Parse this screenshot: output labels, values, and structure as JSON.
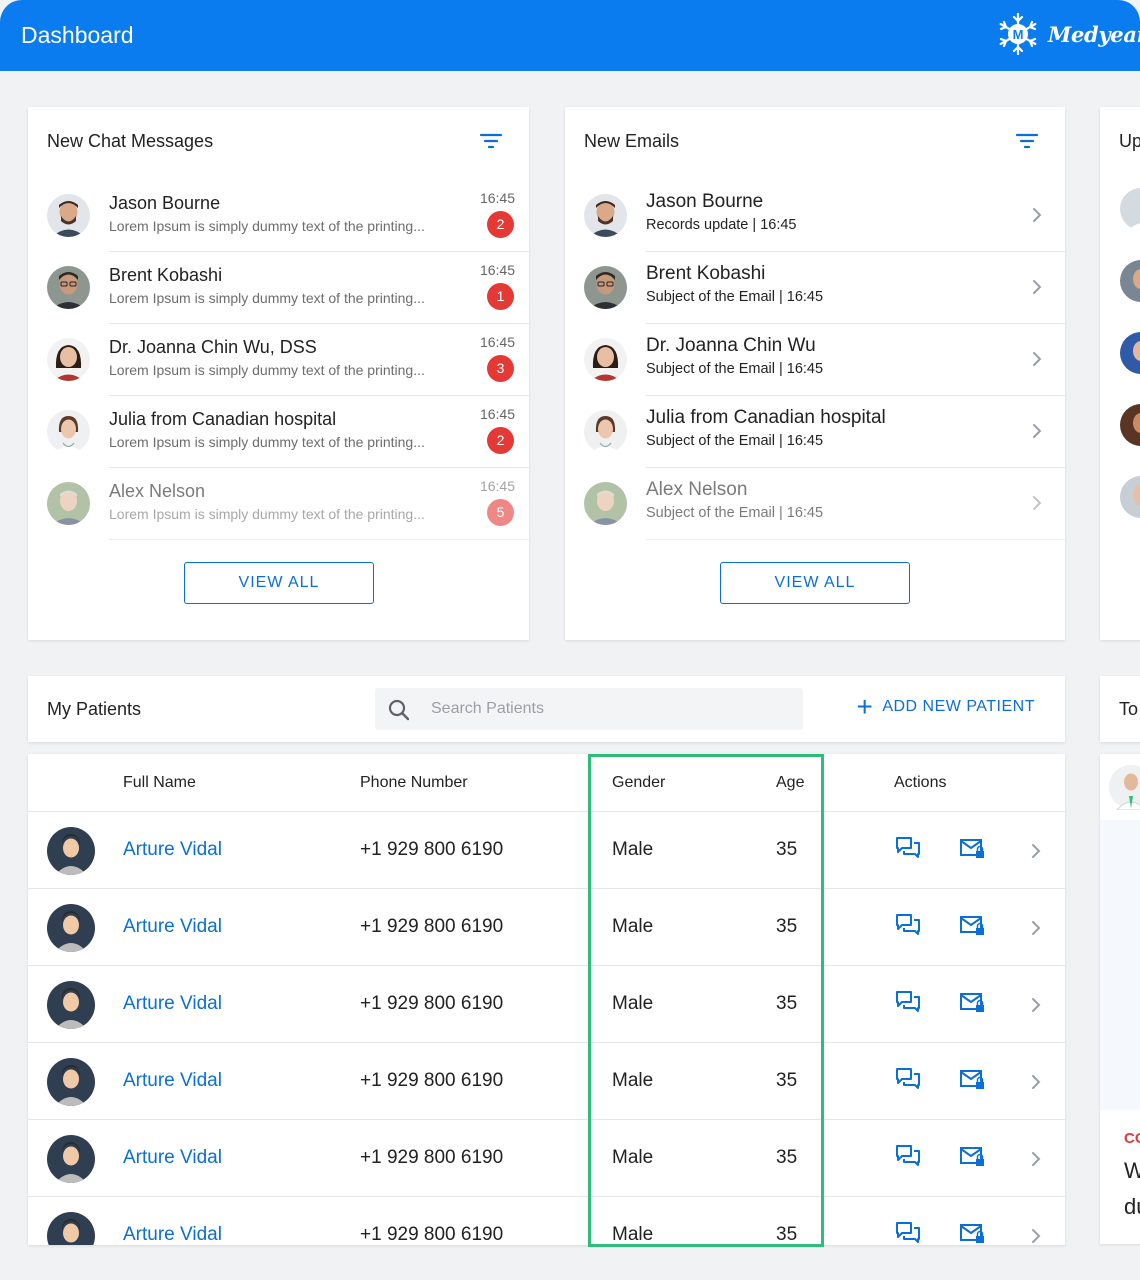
{
  "header": {
    "title": "Dashboard",
    "brand": "Medyear",
    "brand_logo_letter": "M"
  },
  "chat": {
    "title": "New Chat Messages",
    "view_all": "VIEW ALL",
    "items": [
      {
        "name": "Jason Bourne",
        "preview": "Lorem Ipsum is simply dummy text of the printing...",
        "time": "16:45",
        "badge": "2"
      },
      {
        "name": "Brent Kobashi",
        "preview": "Lorem Ipsum is simply dummy text of the printing...",
        "time": "16:45",
        "badge": "1"
      },
      {
        "name": "Dr. Joanna Chin Wu, DSS",
        "preview": "Lorem Ipsum is simply dummy text of the printing...",
        "time": "16:45",
        "badge": "3"
      },
      {
        "name": "Julia from Canadian hospital",
        "preview": "Lorem Ipsum is simply dummy text of the printing...",
        "time": "16:45",
        "badge": "2"
      },
      {
        "name": "Alex Nelson",
        "preview": "Lorem Ipsum is simply dummy text of the printing...",
        "time": "16:45",
        "badge": "5"
      }
    ]
  },
  "emails": {
    "title": "New Emails",
    "view_all": "VIEW ALL",
    "items": [
      {
        "name": "Jason Bourne",
        "subject": "Records update | 16:45"
      },
      {
        "name": "Brent Kobashi",
        "subject": "Subject of the Email | 16:45"
      },
      {
        "name": "Dr. Joanna Chin Wu",
        "subject": "Subject of the Email | 16:45"
      },
      {
        "name": "Julia from Canadian hospital",
        "subject": "Subject of the Email | 16:45"
      },
      {
        "name": "Alex Nelson",
        "subject": "Subject of the Email | 16:45"
      }
    ]
  },
  "upcoming": {
    "title_partial": "Up"
  },
  "patients": {
    "title": "My Patients",
    "search_placeholder": "Search Patients",
    "add_label": "ADD NEW PATIENT",
    "columns": {
      "name": "Full Name",
      "phone": "Phone Number",
      "gender": "Gender",
      "age": "Age",
      "actions": "Actions"
    },
    "rows": [
      {
        "name": "Arture Vidal",
        "phone": "+1 929 800 6190",
        "gender": "Male",
        "age": "35"
      },
      {
        "name": "Arture Vidal",
        "phone": "+1 929 800 6190",
        "gender": "Male",
        "age": "35"
      },
      {
        "name": "Arture Vidal",
        "phone": "+1 929 800 6190",
        "gender": "Male",
        "age": "35"
      },
      {
        "name": "Arture Vidal",
        "phone": "+1 929 800 6190",
        "gender": "Male",
        "age": "35"
      },
      {
        "name": "Arture Vidal",
        "phone": "+1 929 800 6190",
        "gender": "Male",
        "age": "35"
      },
      {
        "name": "Arture Vidal",
        "phone": "+1 929 800 6190",
        "gender": "Male",
        "age": "35"
      }
    ]
  },
  "todo": {
    "title_partial": "To",
    "tag_partial": "CO",
    "text_line1": "W",
    "text_line2": "du"
  },
  "colors": {
    "primary": "#0a7cf0",
    "link": "#0a6fd6",
    "badge": "#e53935",
    "highlight": "#2ebd7b"
  }
}
